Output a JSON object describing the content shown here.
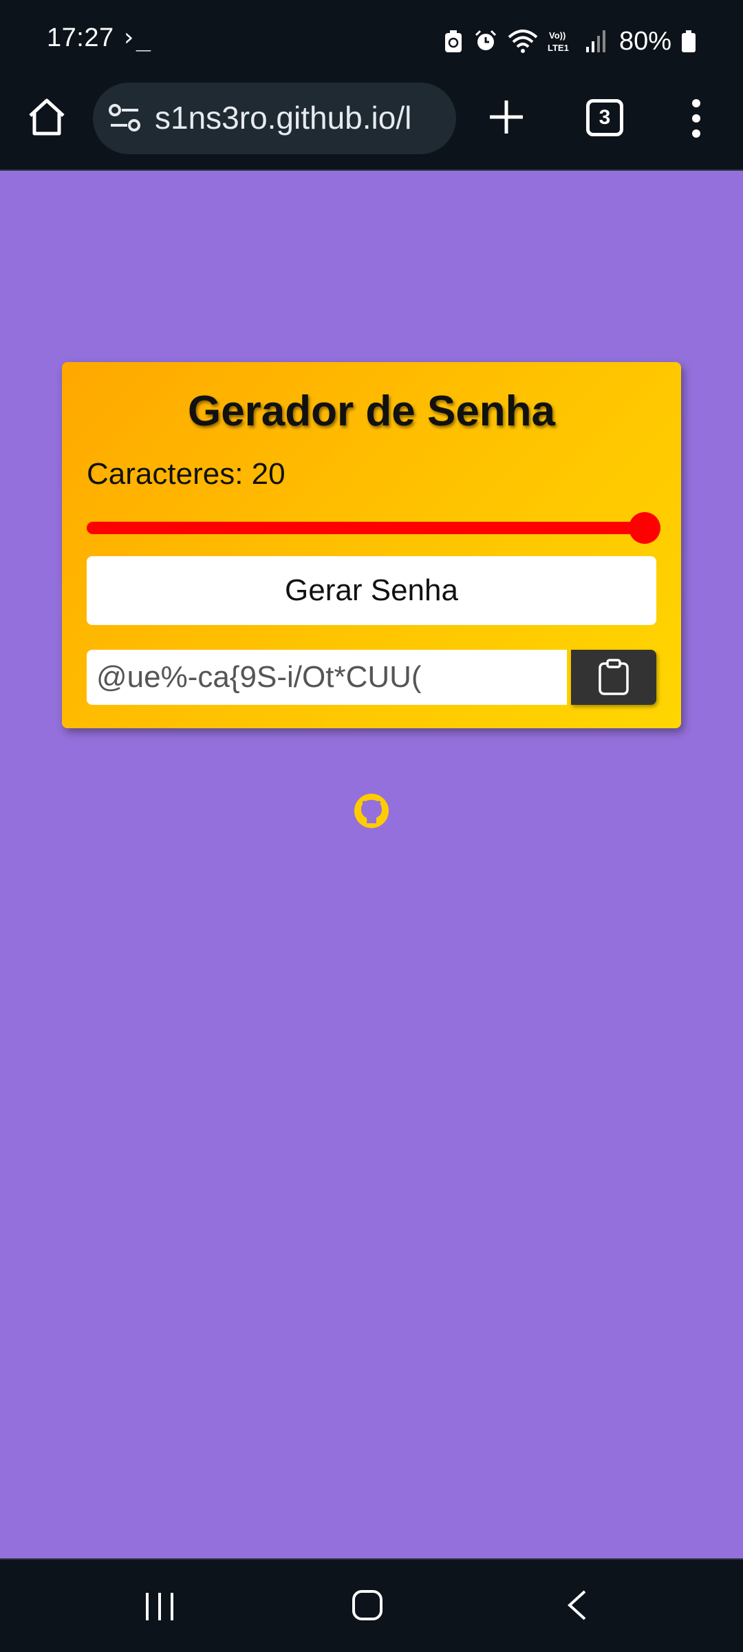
{
  "status_bar": {
    "time": "17:27",
    "terminal_glyph": "›_",
    "battery": "80%"
  },
  "browser": {
    "url": "s1ns3ro.github.io/l",
    "tab_count": "3"
  },
  "app": {
    "title": "Gerador de Senha",
    "length_label": "Caracteres: 20",
    "slider": {
      "min": 4,
      "max": 20,
      "value": 20,
      "color": "#ff0000"
    },
    "generate_button": "Gerar Senha",
    "password": "@ue%-ca{9S-i/Ot*CUU(",
    "copy_icon": "clipboard-icon",
    "footer_icon": "github-icon"
  },
  "colors": {
    "page_background": "#9370db",
    "card_gradient_start": "#ffa800",
    "card_gradient_end": "#ffd600",
    "copy_button": "#333333"
  }
}
